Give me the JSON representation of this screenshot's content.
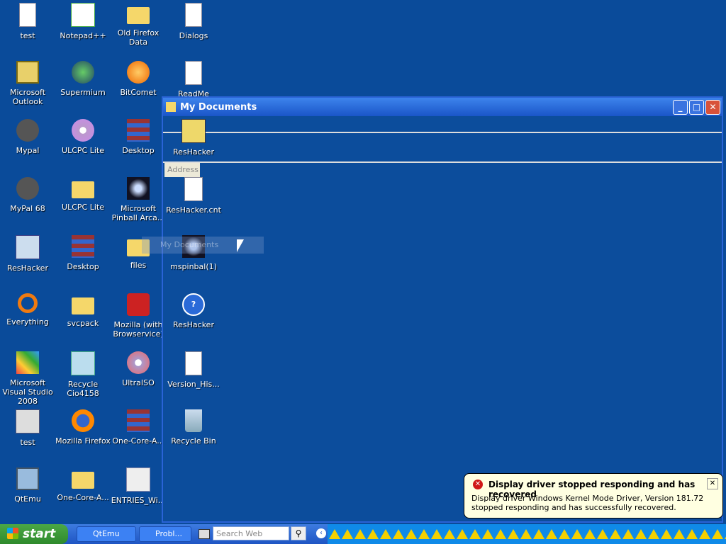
{
  "desktop": {
    "col1": [
      "test",
      "Microsoft Outlook",
      "Mypal",
      "MyPal 68",
      "ResHacker",
      "Everything",
      "Microsoft Visual Studio 2008",
      "test",
      "QtEmu"
    ],
    "col2": [
      "Notepad++",
      "Supermium",
      "ULCPC Lite",
      "ULCPC Lite",
      "Desktop",
      "svcpack",
      "Recycle Cio4158",
      "Mozilla Firefox",
      "One-Core-A..."
    ],
    "col3": [
      "Old Firefox Data",
      "BitComet",
      "Desktop",
      "Microsoft Pinball Arca...",
      "files",
      "Mozilla (with Browservice)",
      "UltraISO",
      "One-Core-A...",
      "ENTRIES_Wi..."
    ],
    "col4": [
      "Dialogs",
      "ReadMe",
      "ResHacker",
      "ResHacker.cnt",
      "mspinbal(1)",
      "ResHacker",
      "Version_His...",
      "Recycle Bin"
    ]
  },
  "window": {
    "title": "My Documents",
    "address_label": "Address",
    "min": "_",
    "max": "□",
    "close": "✕"
  },
  "drag_ghost": "My Documents",
  "taskbar": {
    "start": "start",
    "tasks": [
      "QtEmu",
      "Probl..."
    ],
    "search_placeholder": "Search Web",
    "warning_count": 32
  },
  "balloon": {
    "title": "Display driver stopped responding and has recovered",
    "text": "Display driver Windows Kernel Mode Driver, Version 181.72 stopped responding and has successfully recovered."
  },
  "colors": {
    "desktop": "#0a4b9a",
    "taskbar": "#1f55c4",
    "start": "#2f8a2c",
    "tray": "#0f8ae8"
  }
}
